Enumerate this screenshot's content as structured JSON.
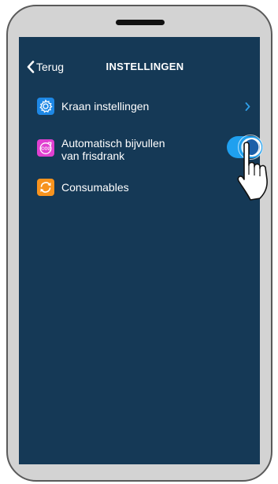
{
  "nav": {
    "back_label": "Terug",
    "title": "INSTELLINGEN"
  },
  "settings": {
    "items": [
      {
        "label": "Kraan instellingen",
        "icon": "gear-icon",
        "icon_color": "#1e88e5",
        "has_chevron": true
      },
      {
        "label_line1": "Automatisch bijvullen",
        "label_line2": "van frisdrank",
        "icon": "co2-icon",
        "icon_color": "#e040d0",
        "toggle_on": true
      },
      {
        "label": "Consumables",
        "icon": "refresh-icon",
        "icon_color": "#f7931e"
      }
    ]
  },
  "colors": {
    "screen_background": "#153956",
    "toggle_on": "#1fa0ef",
    "chevron_accent": "#2f9fe8"
  }
}
